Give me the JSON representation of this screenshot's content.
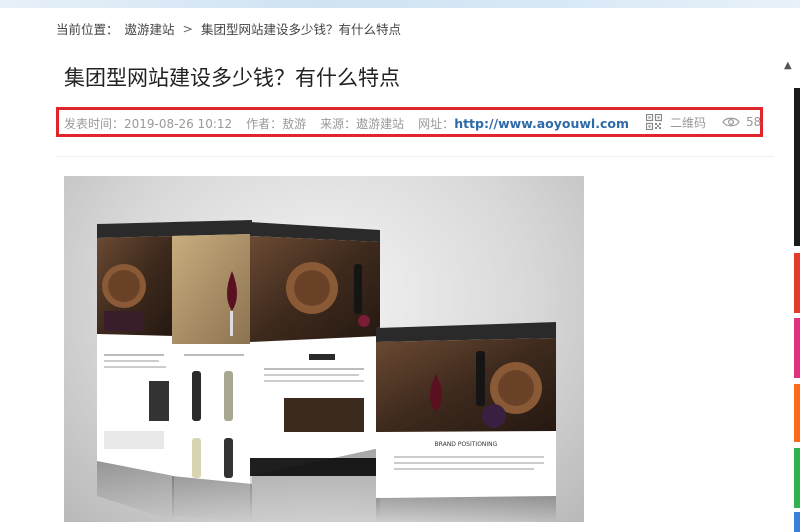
{
  "breadcrumb": {
    "label": "当前位置：",
    "home": "遨游建站",
    "separator": ">",
    "current": "集团型网站建设多少钱？有什么特点"
  },
  "article": {
    "title": "集团型网站建设多少钱？有什么特点",
    "meta": {
      "publish_time": "发表时间：2019-08-26 10:12",
      "author": "作者：敖游",
      "source": "来源：遨游建站",
      "url_label": "网址：",
      "url": "http://www.aoyouwl.com",
      "qr_label": "二维码",
      "views": "58"
    },
    "image": {
      "mock_caption": "BRAND POSITIONING"
    }
  },
  "colors": {
    "highlight_border": "#e0262b",
    "link": "#2e6aa8",
    "meta_text": "#999999"
  },
  "icons": {
    "qr": "qr-code-icon",
    "views": "eye-icon"
  }
}
